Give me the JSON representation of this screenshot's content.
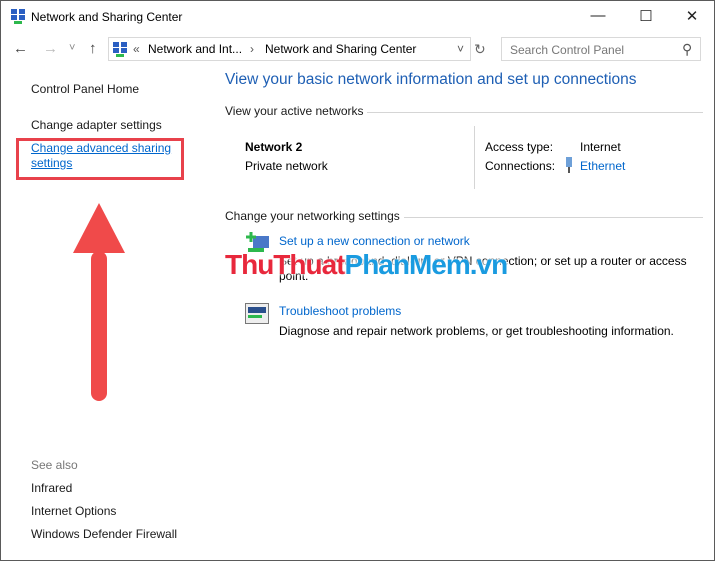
{
  "window": {
    "title": "Network and Sharing Center",
    "minimize": "—",
    "maximize": "☐",
    "close": "✕"
  },
  "nav": {
    "back": "←",
    "forward": "→",
    "recent": "˅",
    "up": "↑",
    "refresh": "↻",
    "dropdown": "˅"
  },
  "address": {
    "overflow": "«",
    "crumbs": [
      "Network and Int...",
      "Network and Sharing Center"
    ],
    "sep": "›"
  },
  "search": {
    "placeholder": "Search Control Panel",
    "icon": "⚲"
  },
  "sidebar": {
    "home": "Control Panel Home",
    "items": [
      "Change adapter settings",
      "Change advanced sharing",
      "settings"
    ],
    "see_also": "See also",
    "see_also_items": [
      "Infrared",
      "Internet Options",
      "Windows Defender Firewall"
    ]
  },
  "main": {
    "heading": "View your basic network information and set up connections",
    "active_label": "View your active networks",
    "network": {
      "name": "Network 2",
      "type": "Private network",
      "access_label": "Access type:",
      "access_value": "Internet",
      "conn_label": "Connections:",
      "conn_value": "Ethernet"
    },
    "change_label": "Change your networking settings",
    "tasks": [
      {
        "title": "Set up a new connection or network",
        "desc1": "Set up a broadband, dial-up, or VPN connection; or set up a router or access",
        "desc2": "point."
      },
      {
        "title": "Troubleshoot problems",
        "desc1": "Diagnose and repair network problems, or get troubleshooting information."
      }
    ]
  },
  "watermark": {
    "part1": "ThuThuat",
    "part2": "PhanMem",
    "part3": ".vn"
  },
  "colors": {
    "link": "#0066cc",
    "heading": "#1e5fb4",
    "highlight": "#e8414b",
    "arrow": "#f04a4a"
  }
}
